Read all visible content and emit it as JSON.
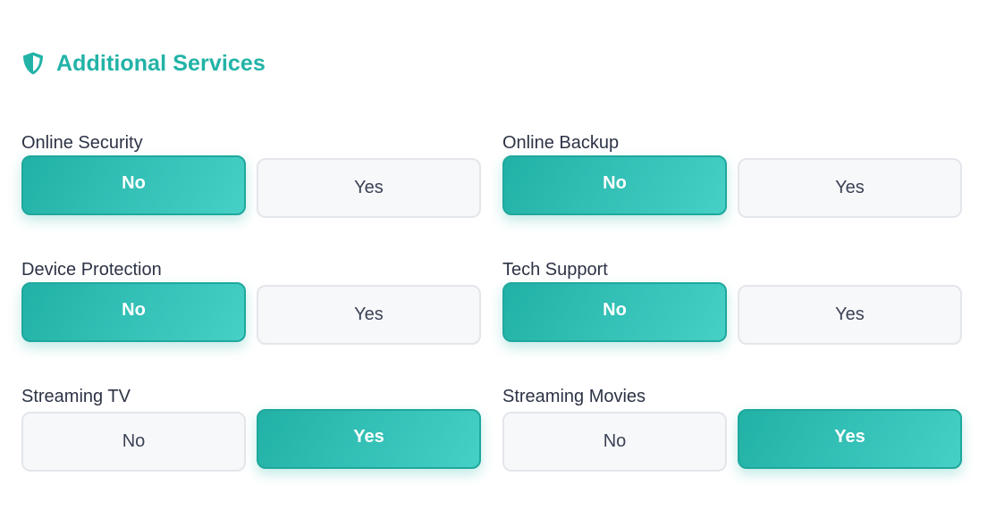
{
  "section": {
    "title": "Additional Services",
    "icon": "shield-icon"
  },
  "colors": {
    "accent": "#22b3a7",
    "accent_light": "#46d0c6",
    "label_text": "#2c3345",
    "unselected_bg": "#f7f8fa",
    "unselected_border": "#e3e6eb"
  },
  "fields": [
    {
      "label": "Online Security",
      "options": [
        "No",
        "Yes"
      ],
      "selected": "No"
    },
    {
      "label": "Online Backup",
      "options": [
        "No",
        "Yes"
      ],
      "selected": "No"
    },
    {
      "label": "Device Protection",
      "options": [
        "No",
        "Yes"
      ],
      "selected": "No"
    },
    {
      "label": "Tech Support",
      "options": [
        "No",
        "Yes"
      ],
      "selected": "No"
    },
    {
      "label": "Streaming TV",
      "options": [
        "No",
        "Yes"
      ],
      "selected": "Yes"
    },
    {
      "label": "Streaming Movies",
      "options": [
        "No",
        "Yes"
      ],
      "selected": "Yes"
    }
  ]
}
